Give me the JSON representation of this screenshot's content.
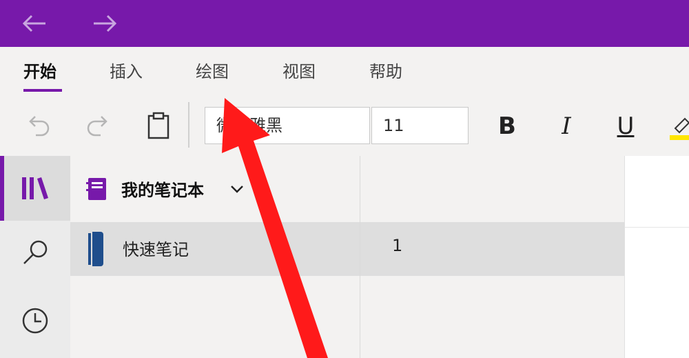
{
  "titlebar": {
    "back_label": "←",
    "forward_label": "→"
  },
  "ribbon": {
    "tabs": [
      {
        "label": "开始",
        "active": true
      },
      {
        "label": "插入"
      },
      {
        "label": "绘图"
      },
      {
        "label": "视图"
      },
      {
        "label": "帮助"
      }
    ],
    "font_name": "微软雅黑",
    "font_size": "11",
    "bold_label": "B",
    "italic_label": "I",
    "underline_label": "U"
  },
  "notebook": {
    "title": "我的笔记本"
  },
  "sections": [
    {
      "label": "快速笔记"
    }
  ],
  "pages": [
    {
      "label": "1"
    }
  ],
  "colors": {
    "accent": "#7719aa",
    "highlight": "#ffe600",
    "section_tab": "#1f4e8c",
    "arrow": "#ff1a1a"
  }
}
